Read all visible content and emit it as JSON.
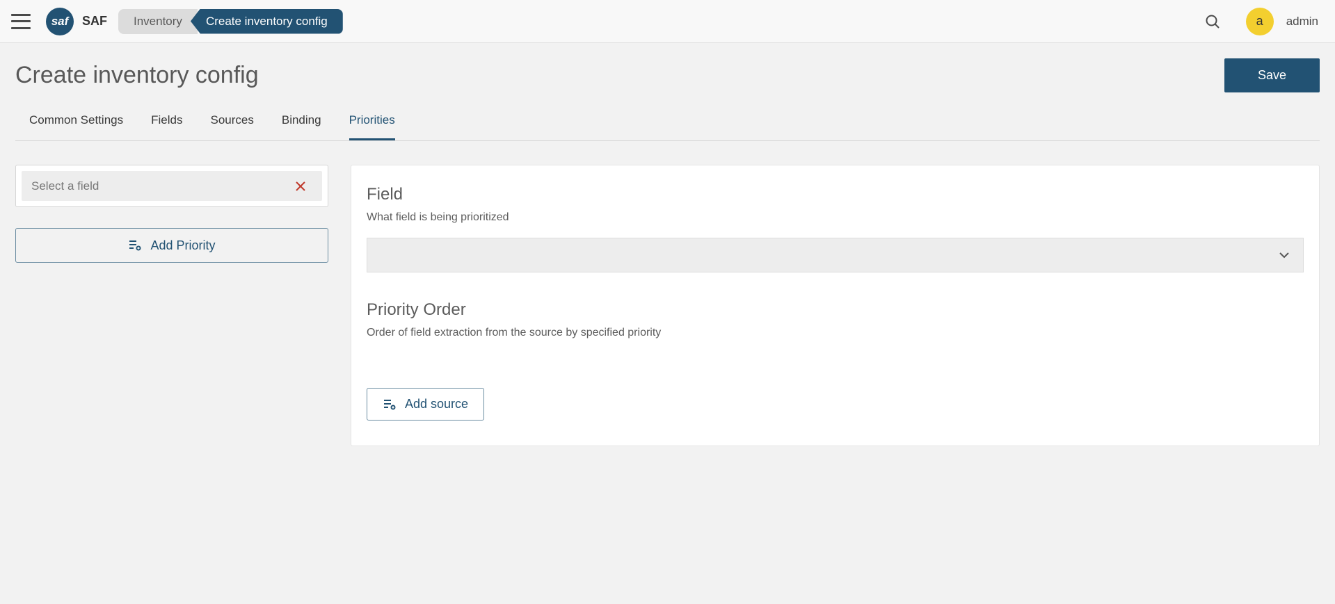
{
  "brand": {
    "logo_text": "saf",
    "name": "SAF"
  },
  "breadcrumbs": {
    "inventory": "Inventory",
    "create": "Create inventory config"
  },
  "user": {
    "avatar_letter": "a",
    "name": "admin"
  },
  "page": {
    "title": "Create inventory config"
  },
  "buttons": {
    "save": "Save",
    "add_priority": "Add Priority",
    "add_source": "Add source"
  },
  "tabs": {
    "items": [
      {
        "label": "Common Settings"
      },
      {
        "label": "Fields"
      },
      {
        "label": "Sources"
      },
      {
        "label": "Binding"
      },
      {
        "label": "Priorities"
      }
    ],
    "active_index": 4
  },
  "left": {
    "select_placeholder": "Select a field"
  },
  "right": {
    "field_heading": "Field",
    "field_desc": "What field is being prioritized",
    "priority_heading": "Priority Order",
    "priority_desc": "Order of field extraction from the source by specified priority"
  }
}
